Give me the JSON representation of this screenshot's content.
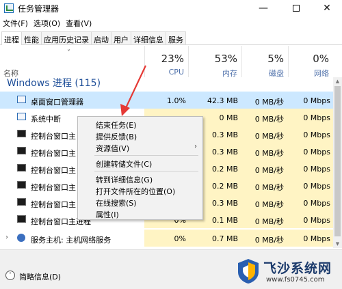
{
  "window": {
    "title": "任务管理器",
    "minimize_glyph": "—",
    "close_glyph": "✕"
  },
  "menu": [
    "文件(F)",
    "选项(O)",
    "查看(V)"
  ],
  "tabs": [
    "进程",
    "性能",
    "应用历史记录",
    "启动",
    "用户",
    "详细信息",
    "服务"
  ],
  "active_tab": "进程",
  "columns": {
    "name": "名称",
    "cpu": {
      "percent": "23%",
      "label": "CPU"
    },
    "memory": {
      "percent": "53%",
      "label": "内存"
    },
    "disk": {
      "percent": "5%",
      "label": "磁盘"
    },
    "network": {
      "percent": "0%",
      "label": "网络"
    }
  },
  "group_header": "Windows 进程 (115)",
  "rows": [
    {
      "name": "桌面窗口管理器",
      "cpu": "1.0%",
      "memory": "42.3 MB",
      "disk": "0 MB/秒",
      "network": "0 Mbps",
      "selected": true
    },
    {
      "name": "系统中断",
      "cpu": "",
      "memory": "0 MB",
      "disk": "0 MB/秒",
      "network": "0 Mbps"
    },
    {
      "name": "控制台窗口主",
      "cpu": "",
      "memory": "0.3 MB",
      "disk": "0 MB/秒",
      "network": "0 Mbps"
    },
    {
      "name": "控制台窗口主",
      "cpu": "",
      "memory": "0.3 MB",
      "disk": "0 MB/秒",
      "network": "0 Mbps"
    },
    {
      "name": "控制台窗口主",
      "cpu": "",
      "memory": "0.2 MB",
      "disk": "0 MB/秒",
      "network": "0 Mbps"
    },
    {
      "name": "控制台窗口主",
      "cpu": "",
      "memory": "0.2 MB",
      "disk": "0 MB/秒",
      "network": "0 Mbps"
    },
    {
      "name": "控制台窗口主",
      "cpu": "",
      "memory": "0.3 MB",
      "disk": "0 MB/秒",
      "network": "0 Mbps"
    },
    {
      "name": "控制台窗口主进程",
      "cpu": "0%",
      "memory": "0.1 MB",
      "disk": "0 MB/秒",
      "network": "0 Mbps"
    },
    {
      "name": "服务主机: 主机网络服务",
      "cpu": "0%",
      "memory": "0.7 MB",
      "disk": "0 MB/秒",
      "network": "0 Mbps"
    }
  ],
  "context_menu": {
    "end_task": "结束任务(E)",
    "feedback": "提供反馈(B)",
    "resource_values": "资源值(V)",
    "create_dump": "创建转储文件(C)",
    "go_to_details": "转到详细信息(G)",
    "open_location": "打开文件所在的位置(O)",
    "search_online": "在线搜索(S)",
    "properties": "属性(I)"
  },
  "footer": {
    "fewer_details": "简略信息(D)"
  },
  "watermark": {
    "name": "飞沙系统网",
    "url": "www.fs0745.com"
  },
  "colors": {
    "selected_row": "#cce8ff",
    "heat_cell": "#fff4c4",
    "arrow": "#e53935"
  }
}
